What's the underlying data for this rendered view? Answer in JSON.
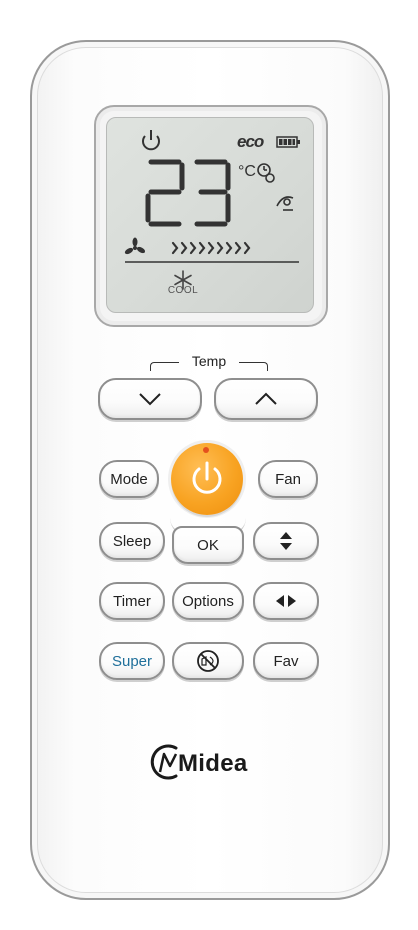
{
  "brand": {
    "name": "Midea"
  },
  "display": {
    "temperature": "23",
    "unit": "°C",
    "eco_label": "eco",
    "mode_label": "COOL",
    "fan_level_bars": 9
  },
  "temp_group": {
    "label": "Temp"
  },
  "buttons": {
    "temp_down": "down-chevron",
    "temp_up": "up-chevron",
    "mode": "Mode",
    "fan": "Fan",
    "sleep": "Sleep",
    "ok": "OK",
    "timer": "Timer",
    "options": "Options",
    "super": "Super",
    "fav": "Fav",
    "vertical_swing": "updown-arrows-icon",
    "horizontal_swing": "leftright-arrows-icon",
    "silent": "no-sound-icon"
  },
  "colors": {
    "power": "#f8a322",
    "super_text": "#1f6f9a",
    "power_dot": "#e4511d"
  }
}
